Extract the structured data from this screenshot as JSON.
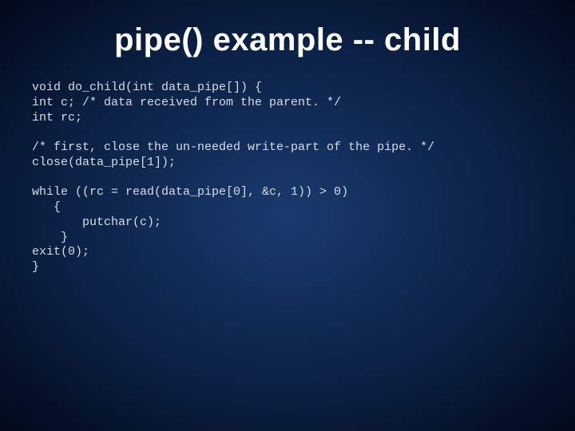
{
  "slide": {
    "title": "pipe() example -- child",
    "code": "void do_child(int data_pipe[]) {\nint c; /* data received from the parent. */\nint rc;\n\n/* first, close the un-needed write-part of the pipe. */\nclose(data_pipe[1]);\n\nwhile ((rc = read(data_pipe[0], &c, 1)) > 0)\n   {\n       putchar(c);\n    }\nexit(0);\n}"
  }
}
